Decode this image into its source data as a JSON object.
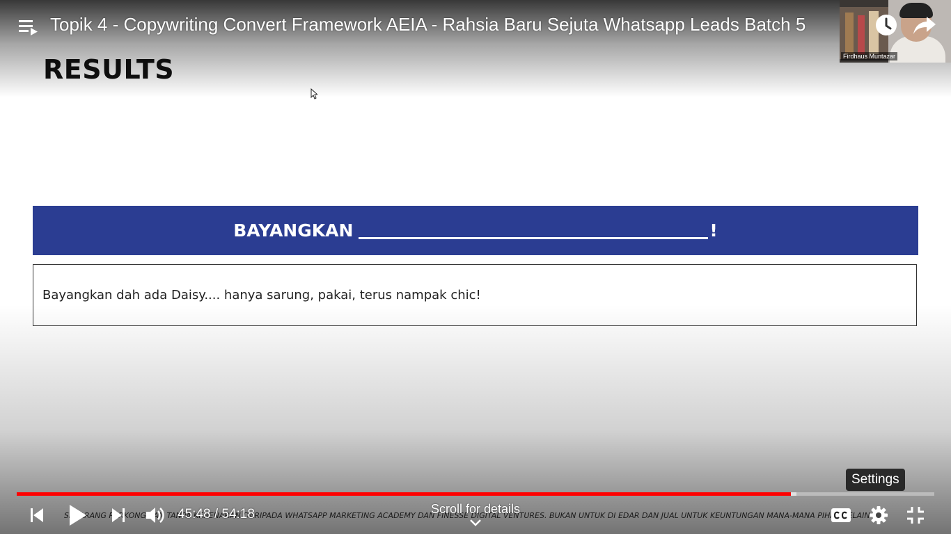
{
  "player": {
    "title": "Topik 4 - Copywriting Convert Framework AEIA - Rahsia Baru Sejuta Whatsapp Leads Batch 5",
    "time_current": "45:48",
    "time_separator": " / ",
    "time_total": "54:18",
    "progress_played_fraction": 0.8437,
    "progress_loaded_fraction": 0.8497,
    "tooltip": "Settings",
    "scroll_hint": "Scroll for details",
    "accent_color": "#ff0000",
    "icons": {
      "playlist": "playlist-icon",
      "watch_later": "clock-icon",
      "share": "share-arrow-icon",
      "previous": "skip-previous-icon",
      "play": "play-icon",
      "next": "skip-next-icon",
      "volume": "volume-icon",
      "captions": "closed-captions-icon",
      "settings": "gear-icon",
      "fullscreen_exit": "exit-fullscreen-icon",
      "scroll": "chevron-down-icon"
    }
  },
  "webcam": {
    "name": "Firdhaus Muntazar"
  },
  "slide": {
    "title": "RESULTS",
    "banner_text": "BAYANGKAN",
    "banner_suffix": "!",
    "banner_color": "#2b3d92",
    "answer": "Bayangkan dah ada Daisy.... hanya sarung, pakai, terus nampak chic!",
    "footer_disclaimer": "SEBARANG PERKONGSIAN TANPA KEBENARAN DARIPADA WHATSAPP MARKETING ACADEMY  DAN FINESSE DIGITAL VENTURES. BUKAN UNTUK DI EDAR DAN JUAL UNTUK KEUNTUNGAN MANA-MANA PIHAK SELAIN PERNIAGAAN, PENGARANG DAN PENERBIT."
  }
}
